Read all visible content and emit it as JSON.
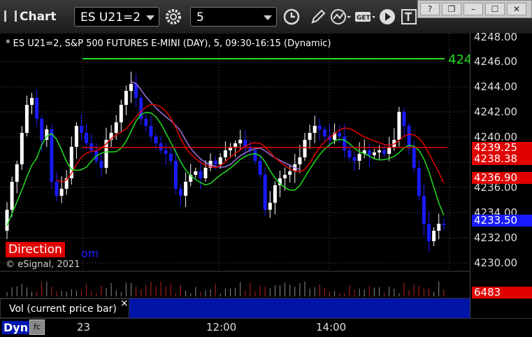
{
  "toolbar": {
    "app_title": "Chart",
    "symbol": "ES U21=2",
    "interval": "5",
    "get_label": "GET"
  },
  "chart": {
    "legend": "* ES U21=2, S&P 500 FUTURES E-MINI (DAY), 5, 09:30-16:15 (Dynamic)",
    "copyright": "© eSignal, 2021",
    "direction_label": "Direction",
    "link_fragment": "om",
    "green_level_label": "424",
    "price_ticks": [
      "4248.00",
      "4246.00",
      "4244.00",
      "4242.00",
      "4240.00",
      "4236.00",
      "4234.00",
      "4232.00",
      "4230.00"
    ],
    "price_tags": {
      "red1": "4239.25",
      "red2": "4238.38",
      "red3": "4236.90",
      "blue": "4233.50",
      "vol": "6483"
    },
    "colors": {
      "up": "#ffffff",
      "down": "#1a1aff",
      "ma_red": "#e00000",
      "ma_green": "#22dd22",
      "ma_purple": "#a070e0"
    }
  },
  "volume_panel": {
    "label": "Vol (current price bar)",
    "close_glyph": "×"
  },
  "time_axis": {
    "mode": "Dyn",
    "lock_glyph": "fc",
    "labels": [
      "23",
      "12:00",
      "14:00"
    ]
  },
  "chart_data": {
    "type": "candlestick",
    "series": [
      {
        "name": "ES U21=2",
        "note": "5-minute bars"
      }
    ]
  }
}
